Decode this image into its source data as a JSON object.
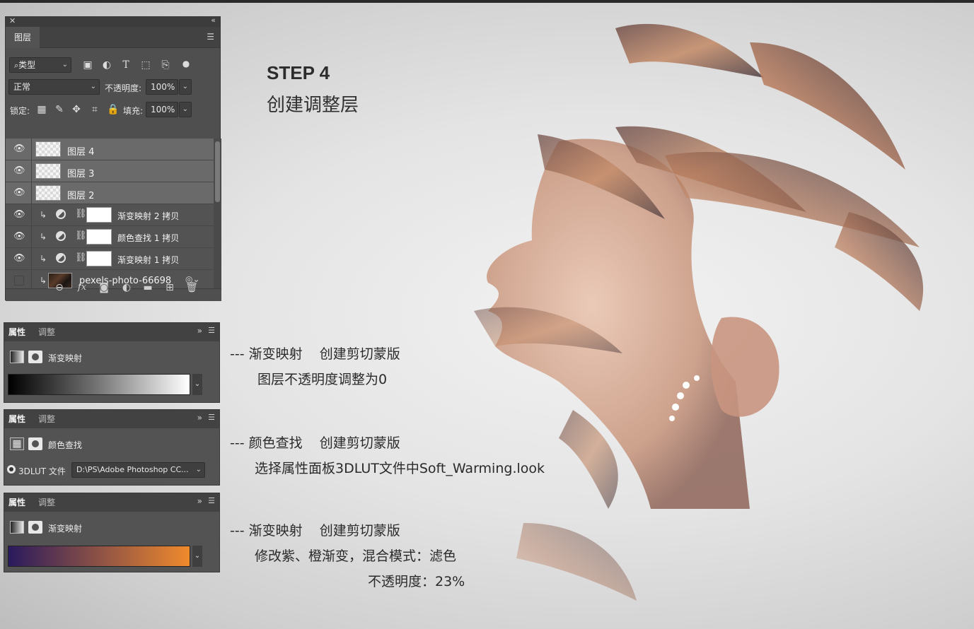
{
  "layers_panel": {
    "tab": "图层",
    "filter_kind": "类型",
    "blend_mode": "正常",
    "opacity_label": "不透明度:",
    "opacity_value": "100%",
    "lock_label": "锁定:",
    "fill_label": "填充:",
    "fill_value": "100%",
    "layers": [
      {
        "name": "图层 4",
        "visible": true,
        "selected": true
      },
      {
        "name": "图层 3",
        "visible": true,
        "selected": true
      },
      {
        "name": "图层 2",
        "visible": true,
        "selected": true
      },
      {
        "name": "渐变映射 2 拷贝",
        "visible": true,
        "selected": false
      },
      {
        "name": "颜色查找 1 拷贝",
        "visible": true,
        "selected": false
      },
      {
        "name": "渐变映射 1 拷贝",
        "visible": true,
        "selected": false
      },
      {
        "name": "pexels-photo-66698",
        "visible": false,
        "selected": false
      }
    ],
    "icons": {
      "filter_icons": [
        "image-filter-icon",
        "adjustment-filter-icon",
        "type-filter-icon",
        "shape-filter-icon",
        "smart-object-filter-icon"
      ],
      "footer_icons": [
        "link-icon",
        "fx-icon",
        "mask-icon",
        "adjustment-icon",
        "folder-icon",
        "new-layer-icon",
        "trash-icon"
      ]
    }
  },
  "properties_panels": [
    {
      "tab_active": "属性",
      "tab_other": "调整",
      "title": "渐变映射",
      "gradient": "black-white"
    },
    {
      "tab_active": "属性",
      "tab_other": "调整",
      "title": "颜色查找",
      "lut_label": "3DLUT 文件",
      "lut_value": "D:\\PS\\Adobe Photoshop CC..."
    },
    {
      "tab_active": "属性",
      "tab_other": "调整",
      "title": "渐变映射",
      "gradient": "purple-orange"
    }
  ],
  "colors": {
    "gradient_purple": "#2a1a5e",
    "gradient_orange": "#f08a2c",
    "panel_bg": "#535353"
  },
  "step": {
    "title": "STEP 4",
    "subtitle": "创建调整层"
  },
  "notes": [
    {
      "line1": "--- 渐变映射    创建剪切蒙版",
      "line2": "图层不透明度调整为0"
    },
    {
      "line1": "--- 颜色查找    创建剪切蒙版",
      "line2": "选择属性面板3DLUT文件中Soft_Warming.look"
    },
    {
      "line1": "--- 渐变映射    创建剪切蒙版",
      "line2": "修改紫、橙渐变，混合模式：滤色",
      "line3": "不透明度：23%"
    }
  ]
}
